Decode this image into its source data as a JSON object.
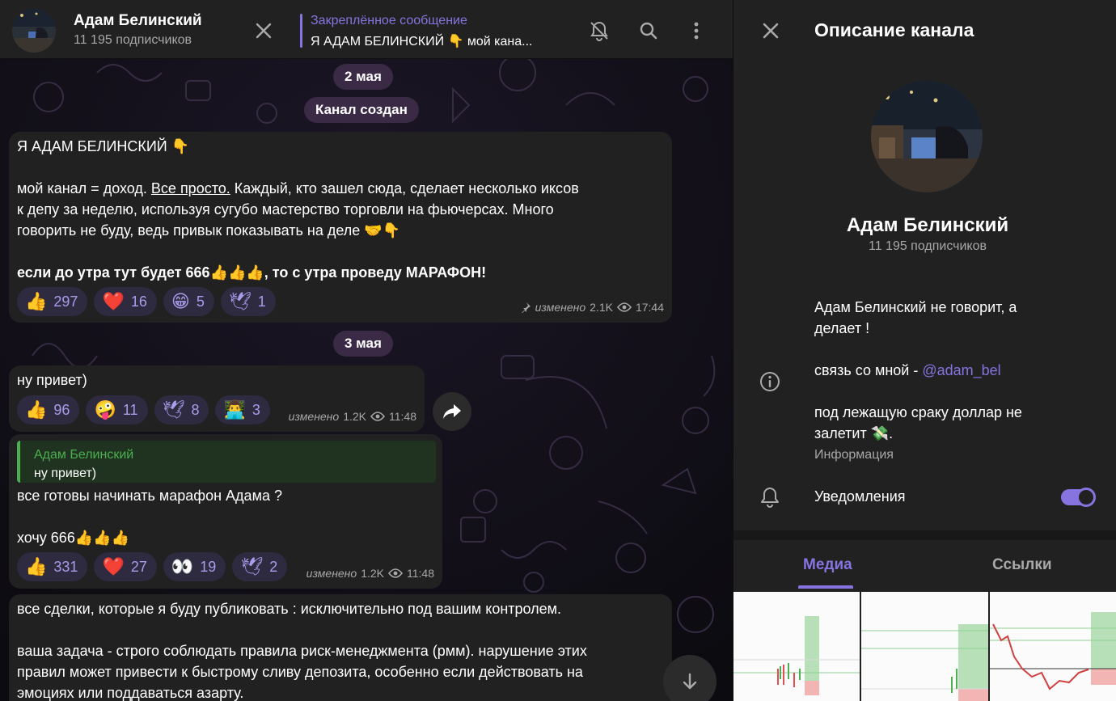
{
  "header": {
    "channel_name": "Адам Белинский",
    "subscribers": "11 195 подписчиков",
    "pinned_title": "Закреплённое сообщение",
    "pinned_text": "Я АДАМ БЕЛИНСКИЙ 👇 мой кана..."
  },
  "dates": {
    "d1": "2 мая",
    "d2": "Канал создан",
    "d3": "3 мая"
  },
  "messages": {
    "m1": {
      "line1": "Я АДАМ БЕЛИНСКИЙ 👇",
      "line2_pre": "мой канал = доход. ",
      "line2_link": "Все просто.",
      "line2_post": " Каждый, кто зашел сюда, сделает несколько иксов",
      "line3": "к депу за неделю, используя сугубо мастерство торговли на фьючерсах. Много",
      "line4": "говорить не буду, ведь привык показывать на деле 🤝👇",
      "line5": "если до утра тут будет 666👍👍👍, то с утра проведу МАРАФОН!",
      "reactions": [
        {
          "emoji": "👍",
          "count": "297"
        },
        {
          "emoji": "❤️",
          "count": "16"
        },
        {
          "emoji": "😁",
          "count": "5"
        },
        {
          "emoji": "🕊",
          "count": "1"
        }
      ],
      "edited": "изменено",
      "views": "2.1K",
      "time": "17:44"
    },
    "m2": {
      "text": "ну привет)",
      "reactions": [
        {
          "emoji": "👍",
          "count": "96"
        },
        {
          "emoji": "🤪",
          "count": "11"
        },
        {
          "emoji": "🕊",
          "count": "8"
        },
        {
          "emoji": "👨‍💻",
          "count": "3"
        }
      ],
      "edited": "изменено",
      "views": "1.2K",
      "time": "11:48"
    },
    "m3": {
      "reply_name": "Адам Белинский",
      "reply_text": "ну привет)",
      "line1": "все готовы начинать марафон Адама ?",
      "line2": "хочу 666👍👍👍",
      "reactions": [
        {
          "emoji": "👍",
          "count": "331"
        },
        {
          "emoji": "❤️",
          "count": "27"
        },
        {
          "emoji": "👀",
          "count": "19"
        },
        {
          "emoji": "🕊",
          "count": "2"
        }
      ],
      "edited": "изменено",
      "views": "1.2K",
      "time": "11:48"
    },
    "m4": {
      "line1": "все сделки, которые я буду публиковать : исключительно под вашим контролем.",
      "line2": "ваша задача - строго соблюдать правила риск-менеджмента (рмм). нарушение этих",
      "line3": "правил может привести к быстрому сливу депозита, особенно если действовать на",
      "line4": "эмоциях или поддаваться азарту."
    }
  },
  "panel": {
    "title": "Описание канала",
    "name": "Адам Белинский",
    "subscribers": "11 195 подписчиков",
    "desc1": "Адам Белинский не говорит, а",
    "desc2": "делает !",
    "desc3_pre": "связь со мной - ",
    "desc3_link": "@adam_bel",
    "desc4": "под лежащую сраку доллар не",
    "desc5": "залетит 💸.",
    "info_label": "Информация",
    "notifications_label": "Уведомления",
    "notifications_on": true,
    "tabs": [
      "Медиа",
      "Ссылки"
    ]
  },
  "colors": {
    "accent": "#8774e1",
    "bubble": "#212121",
    "reply_green": "#4caf50"
  },
  "icons": [
    "close-icon",
    "mute-icon",
    "search-icon",
    "more-icon",
    "forward-icon",
    "arrow-down-icon",
    "info-icon",
    "bell-icon",
    "pin-icon",
    "eye-icon"
  ]
}
